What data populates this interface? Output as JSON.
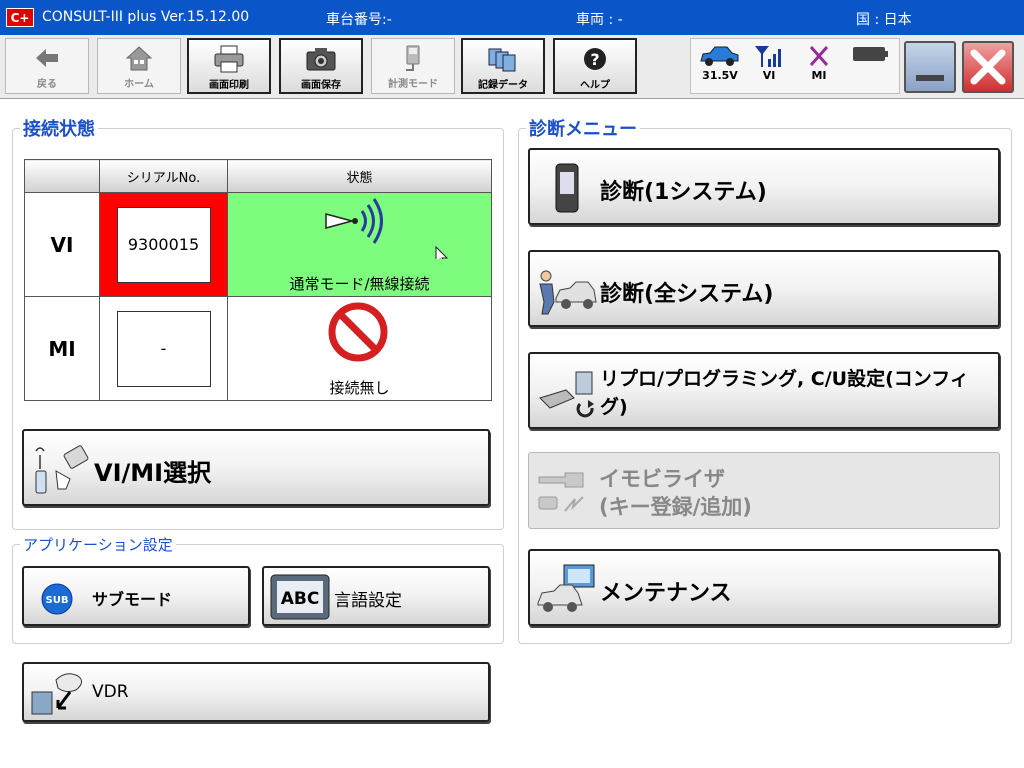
{
  "titlebar": {
    "logo": "C+",
    "app_title": "CONSULT-III plus Ver.15.12.00",
    "chassis_number": "車台番号:-",
    "vehicle": "車両 : -",
    "country": "国 : 日本"
  },
  "toolbar": {
    "back": "戻る",
    "home": "ホーム",
    "print": "画面印刷",
    "save": "画面保存",
    "measure_mode": "計測モード",
    "record_data": "記録データ",
    "help": "ヘルプ"
  },
  "status": {
    "voltage": "31.5V",
    "vi": "VI",
    "mi": "MI"
  },
  "connection": {
    "title": "接続状態",
    "header_serial": "シリアルNo.",
    "header_state": "状態",
    "rows": [
      {
        "label": "VI",
        "serial": "9300015",
        "state": "通常モード/無線接続"
      },
      {
        "label": "MI",
        "serial": "-",
        "state": "接続無し"
      }
    ],
    "vimi_button": "VI/MI選択"
  },
  "app_settings": {
    "title": "アプリケーション設定",
    "sub_mode": "サブモード",
    "sub_icon_text": "SUB",
    "language": "言語設定",
    "language_icon_text": "ABC",
    "vdr": "VDR"
  },
  "diag_menu": {
    "title": "診断メニュー",
    "diag_one": "診断(1システム)",
    "diag_all": "診断(全システム)",
    "reprog_line1": "リプロ/プログラミング, C/U設定(コンフィ",
    "reprog_line2": "グ)",
    "immobilizer_line1": "イモビライザ",
    "immobilizer_line2": "(キー登録/追加)",
    "maintenance": "メンテナンス"
  },
  "colors": {
    "titlebar": "#0a55c8",
    "accent_text": "#1a50c8",
    "vi_connected": "#7dfc7d",
    "alert_red": "#ff0000"
  }
}
